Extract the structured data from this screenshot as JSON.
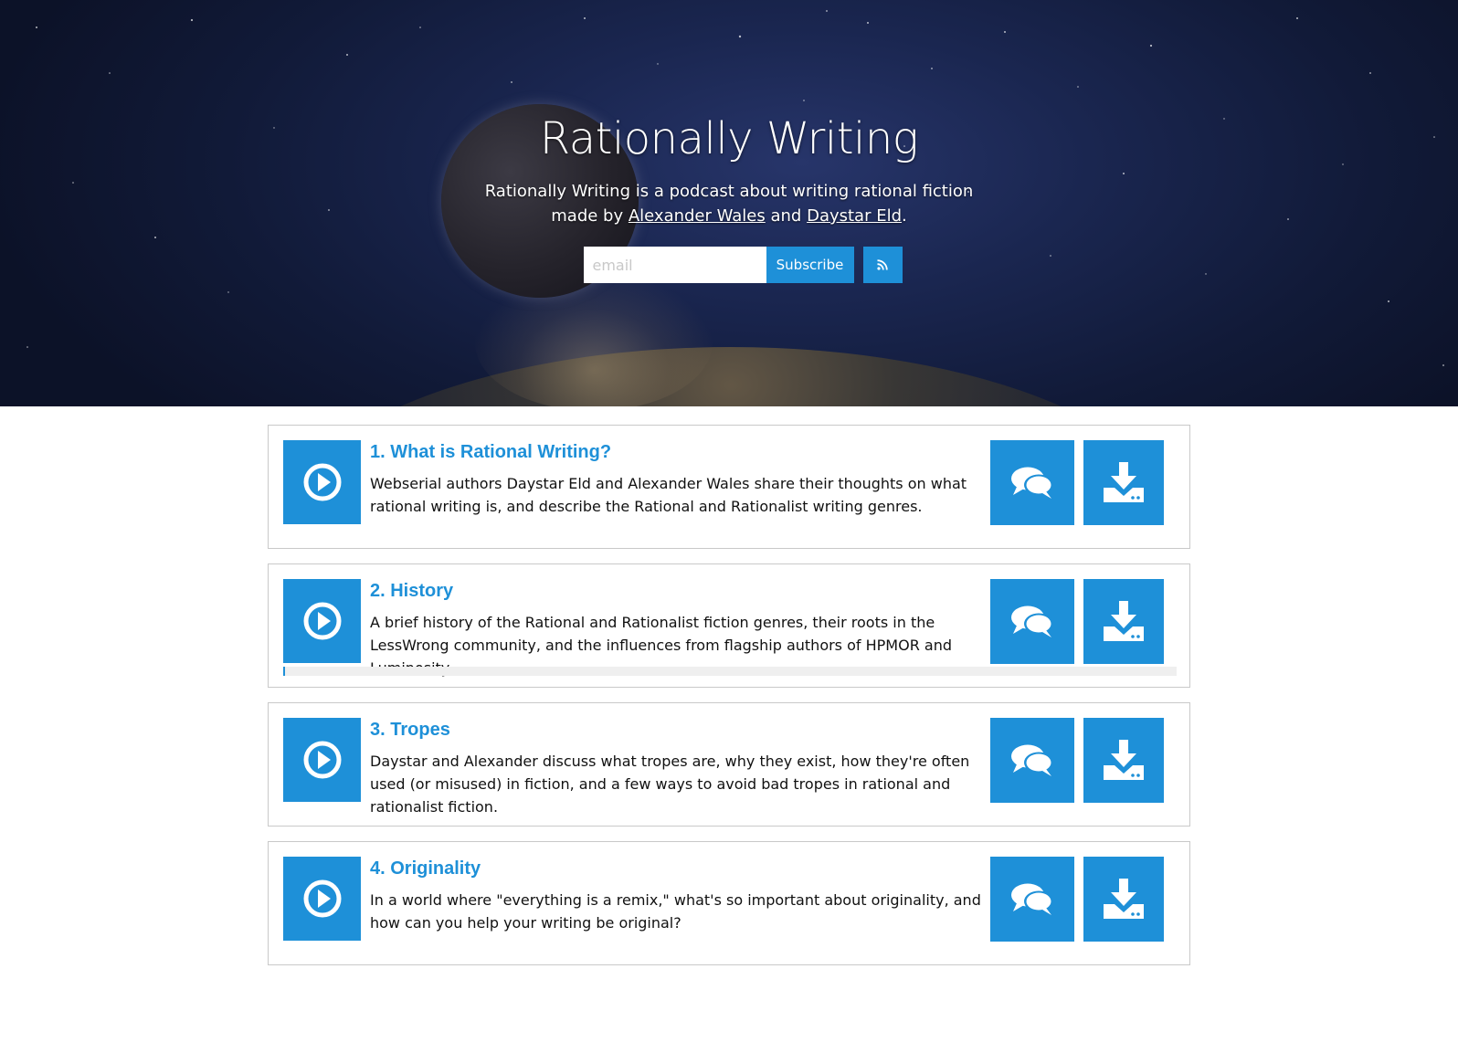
{
  "hero": {
    "title": "Rationally Writing",
    "tagline_before": "Rationally Writing is a podcast about writing rational fiction made by ",
    "author_1": "Alexander Wales",
    "joiner": " and ",
    "author_2": "Daystar Eld",
    "tagline_end": ".",
    "email_placeholder": "email",
    "subscribe_label": "Subscribe",
    "rss_icon": "rss-icon"
  },
  "colors": {
    "accent": "#1e90d8",
    "title_link": "#1e90d8"
  },
  "episodes": [
    {
      "title": "1. What is Rational Writing?",
      "description": "Webserial authors Daystar Eld and Alexander Wales share their thoughts on what rational writing is, and describe the Rational and Rationalist writing genres."
    },
    {
      "title": "2. History",
      "description": "A brief history of the Rational and Rationalist fiction genres, their roots in the LessWrong community, and the influences from flagship authors of HPMOR and Luminosity.",
      "progress": 0
    },
    {
      "title": "3. Tropes",
      "description": "Daystar and Alexander discuss what tropes are, why they exist, how they're often used (or misused) in fiction, and a few ways to avoid bad tropes in rational and rationalist fiction."
    },
    {
      "title": "4. Originality",
      "description": "In a world where \"everything is a remix,\" what's so important about originality, and how can you help your writing be original?"
    }
  ],
  "icons": {
    "play": "play-circle-icon",
    "comments": "comments-icon",
    "download": "download-icon"
  }
}
